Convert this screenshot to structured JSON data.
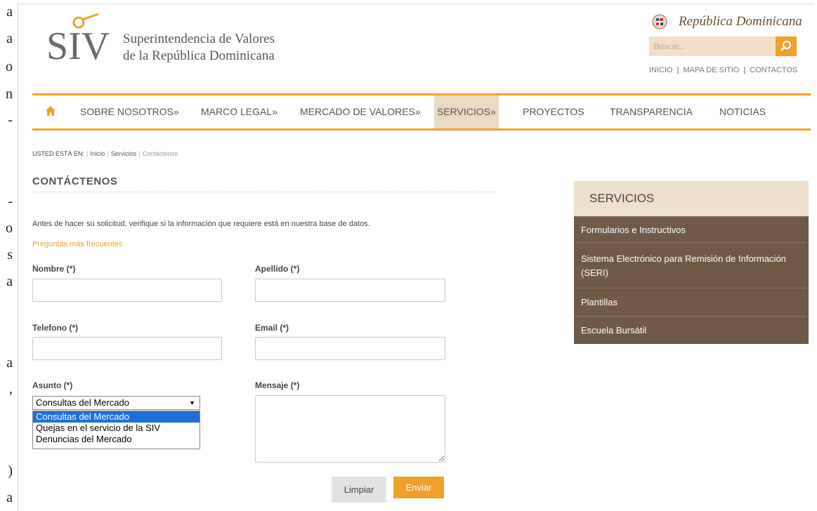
{
  "left_margin_glyphs": [
    "a",
    "a",
    "o",
    "n",
    "-",
    "-",
    "o",
    "s",
    "a",
    "a",
    ",",
    ")",
    "a"
  ],
  "header": {
    "logo_letters": "SIV",
    "org_line1": "Superintendencia de Valores",
    "org_line2": "de la República Dominicana",
    "country_label": "República Dominicana",
    "search_placeholder": "Buscar...",
    "top_links": [
      "INICIO",
      "MAPA DE SITIO",
      "CONTACTOS"
    ]
  },
  "nav": {
    "items": [
      {
        "label": "SOBRE NOSOTROS»"
      },
      {
        "label": "MARCO LEGAL»"
      },
      {
        "label": "MERCADO DE VALORES»"
      },
      {
        "label": "SERVICIOS»",
        "active": true
      },
      {
        "label": "PROYECTOS"
      },
      {
        "label": "TRANSPARENCIA"
      },
      {
        "label": "NOTICIAS"
      }
    ]
  },
  "breadcrumb": {
    "label": "USTED ESTÁ EN:",
    "items": [
      "Inicio",
      "Servicios"
    ],
    "current": "Contáctenos"
  },
  "form": {
    "title": "CONTÁCTENOS",
    "intro": "Antes de hacer su solicitud, verifique si la información que requiere está en nuestra base de datos.",
    "faq_link": "Preguntas más frecuentes",
    "labels": {
      "nombre": "Nombre (*)",
      "apellido": "Apellido (*)",
      "telefono": "Telefono (*)",
      "email": "Email (*)",
      "asunto": "Asunto (*)",
      "mensaje": "Mensaje (*)"
    },
    "asunto_selected": "Consultas del Mercado",
    "asunto_options": [
      "Consultas del Mercado",
      "Quejas en el servicio de la SIV",
      "Denuncias del Mercado"
    ],
    "buttons": {
      "clear": "Limpiar",
      "submit": "Enviar"
    }
  },
  "sidebar": {
    "title": "SERVICIOS",
    "items": [
      {
        "label": "Formularios e Instructivos"
      },
      {
        "label": "Sistema Electrónico para Remisión de Información (SERI)"
      },
      {
        "label": "Plantillas"
      },
      {
        "label": "Escuela Bursátil"
      }
    ]
  },
  "colors": {
    "accent": "#f0a12a",
    "sidebar_item": "#6e5a46",
    "sidebar_head": "#eee0cc",
    "nav_active": "#ead9c4"
  }
}
